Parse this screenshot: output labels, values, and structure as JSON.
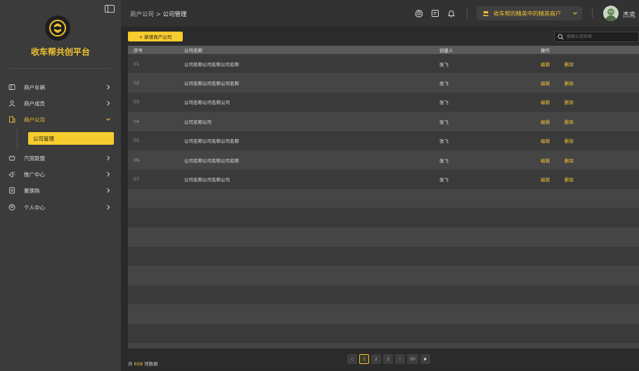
{
  "sidebar": {
    "brand": "收车帮共创平台",
    "items": [
      {
        "label": "商户车辆",
        "icon": "car-icon"
      },
      {
        "label": "商户成员",
        "icon": "members-icon"
      },
      {
        "label": "商户公司",
        "icon": "company-icon",
        "expanded": true
      },
      {
        "label": "汽贸联盟",
        "icon": "alliance-icon"
      },
      {
        "label": "推广中心",
        "icon": "promotion-icon"
      },
      {
        "label": "置换购",
        "icon": "exchange-icon"
      },
      {
        "label": "个人中心",
        "icon": "profile-icon"
      }
    ],
    "sub_item": "公司管理"
  },
  "header": {
    "breadcrumb_parent": "商户公司",
    "breadcrumb_sep": " > ",
    "breadcrumb_current": "公司管理",
    "merchant": "收车帮的精英中的精英商户",
    "username": "杰克"
  },
  "toolbar": {
    "add_label": "+ 新增商户公司",
    "search_placeholder": "搜索公司名称"
  },
  "table": {
    "columns": [
      "序号",
      "公司名称",
      "创建人",
      "操作"
    ],
    "rows": [
      {
        "no": "01",
        "name": "公司名称公司名称公司名称",
        "creator": "张飞",
        "edit": "编辑",
        "delete": "删除"
      },
      {
        "no": "02",
        "name": "公司名称公司名称公司名称",
        "creator": "张飞",
        "edit": "编辑",
        "delete": "删除"
      },
      {
        "no": "03",
        "name": "公司名称公司名称公司",
        "creator": "张飞",
        "edit": "编辑",
        "delete": "删除"
      },
      {
        "no": "04",
        "name": "公司名称公司",
        "creator": "张飞",
        "edit": "编辑",
        "delete": "删除"
      },
      {
        "no": "05",
        "name": "公司名称公司名称公司名称",
        "creator": "张飞",
        "edit": "编辑",
        "delete": "删除"
      },
      {
        "no": "06",
        "name": "公司名称公司名称公司名称",
        "creator": "张飞",
        "edit": "编辑",
        "delete": "删除"
      },
      {
        "no": "07",
        "name": "公司名称公司名称公司",
        "creator": "张飞",
        "edit": "编辑",
        "delete": "删除"
      }
    ]
  },
  "footer": {
    "total_prefix": "共",
    "total": "658",
    "total_suffix": "项数据",
    "pages": [
      "1",
      "2",
      "3",
      "···",
      "90"
    ],
    "current_page": "1"
  },
  "colors": {
    "accent": "#f7cc2f",
    "sidebar_bg": "#3b3b3b",
    "header_bg": "#323232"
  }
}
